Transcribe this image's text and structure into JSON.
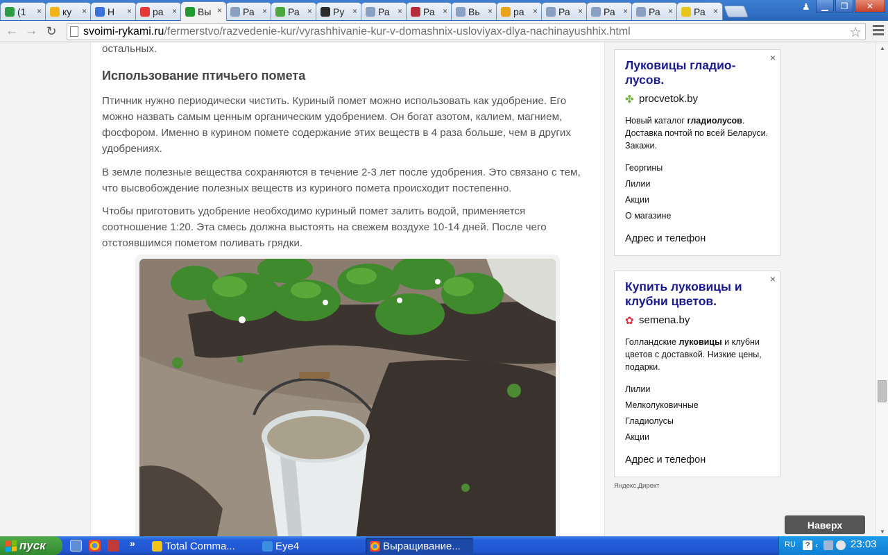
{
  "browser": {
    "tabs": [
      {
        "label": "(1",
        "icon": "target-icon",
        "color": "#2e9b46",
        "active": false
      },
      {
        "label": "ку",
        "icon": "drive-icon",
        "color": "#f2b417",
        "active": false
      },
      {
        "label": "Н",
        "icon": "docs-icon",
        "color": "#3b72d9",
        "active": false
      },
      {
        "label": "ра",
        "icon": "yandex-icon",
        "color": "#e53935",
        "active": false
      },
      {
        "label": "Вы",
        "icon": "arrow-right-icon",
        "color": "#1e9a2e",
        "active": true
      },
      {
        "label": "Ра",
        "icon": "page-icon",
        "color": "#8aa0c2",
        "active": false
      },
      {
        "label": "Ра",
        "icon": "butterfly-icon",
        "color": "#4aa83c",
        "active": false
      },
      {
        "label": "Ру",
        "icon": "play-icon",
        "color": "#2b2b2b",
        "active": false
      },
      {
        "label": "Ра",
        "icon": "page-icon",
        "color": "#8aa0c2",
        "active": false
      },
      {
        "label": "Ра",
        "icon": "flower-icon",
        "color": "#b52d3a",
        "active": false
      },
      {
        "label": "Вь",
        "icon": "page-icon",
        "color": "#8aa0c2",
        "active": false
      },
      {
        "label": "ра",
        "icon": "image-icon",
        "color": "#e8a31a",
        "active": false
      },
      {
        "label": "Ра",
        "icon": "page-icon",
        "color": "#8aa0c2",
        "active": false
      },
      {
        "label": "Ра",
        "icon": "page-icon",
        "color": "#8aa0c2",
        "active": false
      },
      {
        "label": "Ра",
        "icon": "page-icon",
        "color": "#8aa0c2",
        "active": false
      },
      {
        "label": "Ра",
        "icon": "d-icon",
        "color": "#e8c51a",
        "active": false
      }
    ],
    "close_glyph": "×",
    "url_host": "svoimi-rykami.ru",
    "url_path": "/fermerstvo/razvedenie-kur/vyrashhivanie-kur-v-domashnix-usloviyax-dlya-nachinayushhix.html",
    "star_glyph": "☆"
  },
  "article": {
    "lead_fragment": "остальных.",
    "heading": "Использование птичьего помета",
    "paragraphs": [
      "Птичник нужно периодически чистить. Куриный помет можно использовать как удобрение. Его можно назвать самым ценным органическим удобрением. Он богат азотом, калием, магнием, фосфором. Именно в курином помете содержание этих веществ в 4 раза больше, чем в других удобрениях.",
      "В земле полезные вещества сохраняются в течение 2-3 лет после удобрения. Это связано с тем, что высвобождение полезных веществ из куриного помета происходит постепенно.",
      "Чтобы приготовить удобрение необходимо куриный помет залить водой, применяется соотношение 1:20. Эта смесь должна выстоять на свежем воздухе 10-14 дней. После чего отстоявшимся пометом поливать грядки."
    ]
  },
  "ads": [
    {
      "title": "Луковицы гладио-лусов.",
      "site": "procvetok.by",
      "site_icon_color": "#6fb43c",
      "desc_before": "Новый каталог ",
      "desc_bold": "гладиолусов",
      "desc_after": ". Доставка почтой по всей Беларуси. Закажи.",
      "links": [
        "Георгины",
        "Лилии",
        "Акции",
        "О магазине"
      ],
      "contact": "Адрес и телефон"
    },
    {
      "title": "Купить луковицы и клубни цветов.",
      "site": "semena.by",
      "site_icon_color": "#d6303a",
      "desc_before": "Голландские ",
      "desc_bold": "луковицы",
      "desc_after": " и клубни цветов с доставкой. Низкие цены, подарки.",
      "links": [
        "Лилии",
        "Мелколуковичные",
        "Гладиолусы",
        "Акции"
      ],
      "contact": "Адрес и телефон"
    }
  ],
  "direct_label": "Яндекс.Директ",
  "to_top_label": "Наверх",
  "taskbar": {
    "start_label": "пуск",
    "quick_more": "»",
    "tasks": [
      {
        "label": "Total Comma...",
        "icon_color": "#f0c419",
        "active": false
      },
      {
        "label": "Eye4",
        "icon_color": "#3b8de0",
        "active": false
      },
      {
        "label": "Выращивание...",
        "icon_color": "#d93b2b",
        "active": true
      }
    ],
    "lang": "RU",
    "clock": "23:03"
  }
}
